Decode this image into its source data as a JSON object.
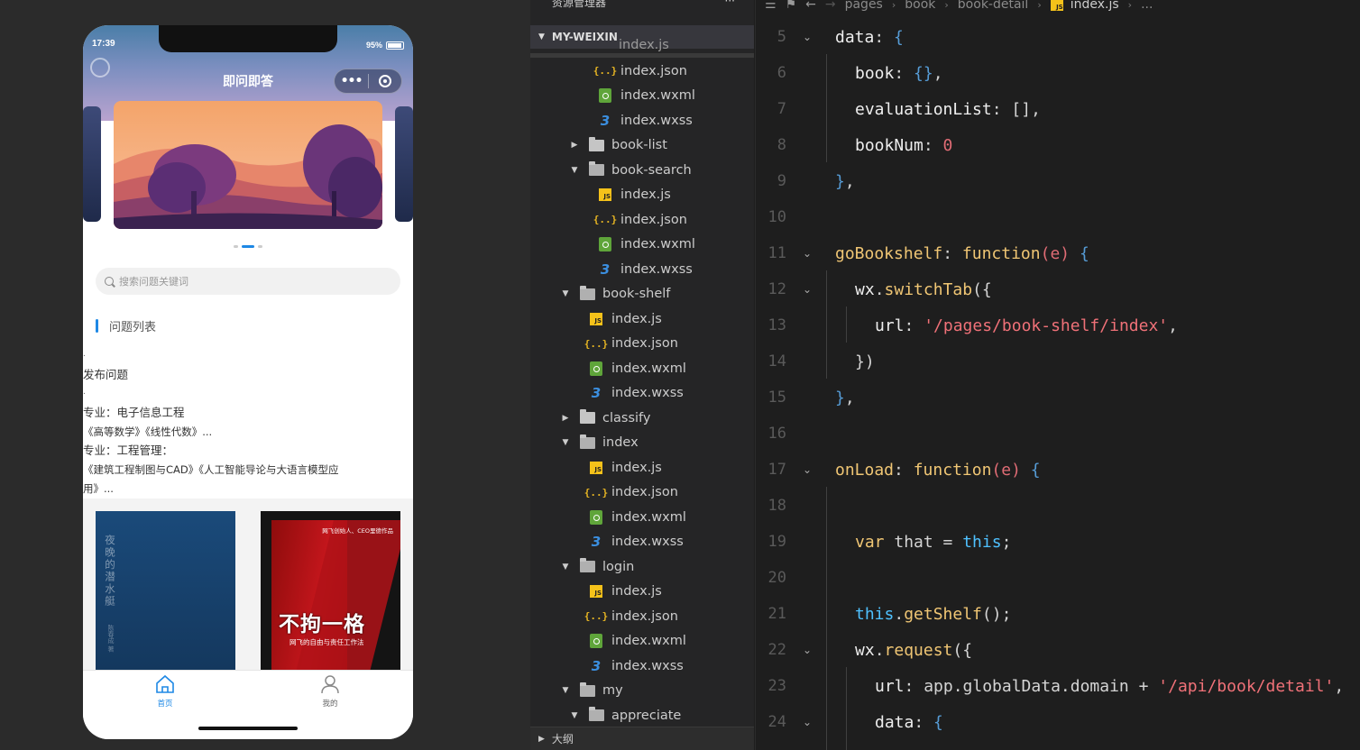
{
  "simulator": {
    "status_time": "17:39",
    "battery": "95%",
    "nav_title": "即问即答",
    "search_placeholder": "搜索问题关键词",
    "section_title": "问题列表",
    "dot1": ".",
    "post_question": "发布问题",
    "dot2": ".",
    "major1": "专业：电子信息工程",
    "books1": "《高等数学》《线性代数》...",
    "major2": "专业：工程管理：",
    "books2a": "《建筑工程制图与CAD》《人工智能导论与大语言模型应",
    "books2b": "用》...",
    "book1_title": "夜晚的潜水艇",
    "book1_author": "陈春成 著",
    "book2_title": "不拘一格",
    "book2_subtitle": "网飞的自由与责任工作法",
    "book2_corner": "网飞创始人、CEO里德作品",
    "tabs": [
      {
        "label": "首页",
        "icon": "home-icon",
        "active": true
      },
      {
        "label": "我的",
        "icon": "user-icon",
        "active": false
      }
    ],
    "accent_color": "#1e88e5"
  },
  "explorer": {
    "header": "资源管理器",
    "header_more": "···",
    "project": "MY-WEIXIN",
    "partial_top": "index.js",
    "items": [
      {
        "label": "index.json",
        "type": "json",
        "depth": 3
      },
      {
        "label": "index.wxml",
        "type": "wxml",
        "depth": 3
      },
      {
        "label": "index.wxss",
        "type": "wxss",
        "depth": 3
      },
      {
        "label": "book-list",
        "type": "folder",
        "depth": 2,
        "open": false
      },
      {
        "label": "book-search",
        "type": "folder",
        "depth": 2,
        "open": true
      },
      {
        "label": "index.js",
        "type": "js",
        "depth": 3
      },
      {
        "label": "index.json",
        "type": "json",
        "depth": 3
      },
      {
        "label": "index.wxml",
        "type": "wxml",
        "depth": 3
      },
      {
        "label": "index.wxss",
        "type": "wxss",
        "depth": 3
      },
      {
        "label": "book-shelf",
        "type": "folder",
        "depth": 1,
        "open": true
      },
      {
        "label": "index.js",
        "type": "js",
        "depth": 2
      },
      {
        "label": "index.json",
        "type": "json",
        "depth": 2
      },
      {
        "label": "index.wxml",
        "type": "wxml",
        "depth": 2
      },
      {
        "label": "index.wxss",
        "type": "wxss",
        "depth": 2
      },
      {
        "label": "classify",
        "type": "folder",
        "depth": 1,
        "open": false
      },
      {
        "label": "index",
        "type": "folder",
        "depth": 1,
        "open": true
      },
      {
        "label": "index.js",
        "type": "js",
        "depth": 2
      },
      {
        "label": "index.json",
        "type": "json",
        "depth": 2
      },
      {
        "label": "index.wxml",
        "type": "wxml",
        "depth": 2
      },
      {
        "label": "index.wxss",
        "type": "wxss",
        "depth": 2
      },
      {
        "label": "login",
        "type": "folder",
        "depth": 1,
        "open": true
      },
      {
        "label": "index.js",
        "type": "js",
        "depth": 2
      },
      {
        "label": "index.json",
        "type": "json",
        "depth": 2
      },
      {
        "label": "index.wxml",
        "type": "wxml",
        "depth": 2
      },
      {
        "label": "index.wxss",
        "type": "wxss",
        "depth": 2
      },
      {
        "label": "my",
        "type": "folder",
        "depth": 1,
        "open": true
      },
      {
        "label": "appreciate",
        "type": "folder",
        "depth": 2,
        "open": true
      }
    ],
    "outline": "大纲"
  },
  "editor": {
    "breadcrumb": [
      "pages",
      "book",
      "book-detail",
      "index.js",
      "..."
    ],
    "lines": [
      {
        "n": "5",
        "fold": true,
        "indent": 0,
        "tokens": [
          [
            "prop",
            "data"
          ],
          [
            "punc",
            ": "
          ],
          [
            "brace",
            "{"
          ]
        ]
      },
      {
        "n": "6",
        "fold": false,
        "indent": 1,
        "tokens": [
          [
            "prop",
            "book"
          ],
          [
            "punc",
            ": "
          ],
          [
            "brace",
            "{}"
          ],
          [
            "punc",
            ","
          ]
        ]
      },
      {
        "n": "7",
        "fold": false,
        "indent": 1,
        "tokens": [
          [
            "prop",
            "evaluationList"
          ],
          [
            "punc",
            ": "
          ],
          [
            "punc",
            "[]"
          ],
          [
            "punc",
            ","
          ]
        ]
      },
      {
        "n": "8",
        "fold": false,
        "indent": 1,
        "tokens": [
          [
            "prop",
            "bookNum"
          ],
          [
            "punc",
            ": "
          ],
          [
            "num",
            "0"
          ]
        ]
      },
      {
        "n": "9",
        "fold": false,
        "indent": 0,
        "tokens": [
          [
            "brace",
            "}"
          ],
          [
            "punc",
            ","
          ]
        ]
      },
      {
        "n": "10",
        "fold": false,
        "indent": 0,
        "tokens": []
      },
      {
        "n": "11",
        "fold": true,
        "indent": 0,
        "tokens": [
          [
            "name",
            "goBookshelf"
          ],
          [
            "punc",
            ": "
          ],
          [
            "key",
            "function"
          ],
          [
            "par",
            "("
          ],
          [
            "par",
            "e"
          ],
          [
            "par",
            ")"
          ],
          [
            "punc",
            " "
          ],
          [
            "brace",
            "{"
          ]
        ]
      },
      {
        "n": "12",
        "fold": true,
        "indent": 1,
        "tokens": [
          [
            "prop",
            "wx"
          ],
          [
            "punc",
            "."
          ],
          [
            "fn",
            "switchTab"
          ],
          [
            "punc",
            "({"
          ]
        ]
      },
      {
        "n": "13",
        "fold": false,
        "indent": 2,
        "tokens": [
          [
            "prop",
            "url"
          ],
          [
            "punc",
            ": "
          ],
          [
            "str",
            "'/pages/book-shelf/index'"
          ],
          [
            "punc",
            ","
          ]
        ]
      },
      {
        "n": "14",
        "fold": false,
        "indent": 1,
        "tokens": [
          [
            "punc",
            "})"
          ]
        ]
      },
      {
        "n": "15",
        "fold": false,
        "indent": 0,
        "tokens": [
          [
            "brace",
            "}"
          ],
          [
            "punc",
            ","
          ]
        ]
      },
      {
        "n": "16",
        "fold": false,
        "indent": 0,
        "tokens": []
      },
      {
        "n": "17",
        "fold": true,
        "indent": 0,
        "tokens": [
          [
            "name",
            "onLoad"
          ],
          [
            "punc",
            ": "
          ],
          [
            "key",
            "function"
          ],
          [
            "par",
            "("
          ],
          [
            "par",
            "e"
          ],
          [
            "par",
            ")"
          ],
          [
            "punc",
            " "
          ],
          [
            "brace",
            "{"
          ]
        ]
      },
      {
        "n": "18",
        "fold": false,
        "indent": 0,
        "tokens": []
      },
      {
        "n": "19",
        "fold": false,
        "indent": 1,
        "tokens": [
          [
            "var",
            "var"
          ],
          [
            "punc",
            " that = "
          ],
          [
            "this",
            "this"
          ],
          [
            "punc",
            ";"
          ]
        ]
      },
      {
        "n": "20",
        "fold": false,
        "indent": 0,
        "tokens": []
      },
      {
        "n": "21",
        "fold": false,
        "indent": 1,
        "tokens": [
          [
            "this",
            "this"
          ],
          [
            "punc",
            "."
          ],
          [
            "fn",
            "getShelf"
          ],
          [
            "punc",
            "();"
          ]
        ]
      },
      {
        "n": "22",
        "fold": true,
        "indent": 1,
        "tokens": [
          [
            "prop",
            "wx"
          ],
          [
            "punc",
            "."
          ],
          [
            "fn",
            "request"
          ],
          [
            "punc",
            "({"
          ]
        ]
      },
      {
        "n": "23",
        "fold": false,
        "indent": 2,
        "tokens": [
          [
            "prop",
            "url"
          ],
          [
            "punc",
            ": app.globalData.domain + "
          ],
          [
            "str",
            "'/api/book/detail'"
          ],
          [
            "punc",
            ","
          ]
        ]
      },
      {
        "n": "24",
        "fold": true,
        "indent": 2,
        "tokens": [
          [
            "prop",
            "data"
          ],
          [
            "punc",
            ": "
          ],
          [
            "brace",
            "{"
          ]
        ]
      }
    ]
  }
}
